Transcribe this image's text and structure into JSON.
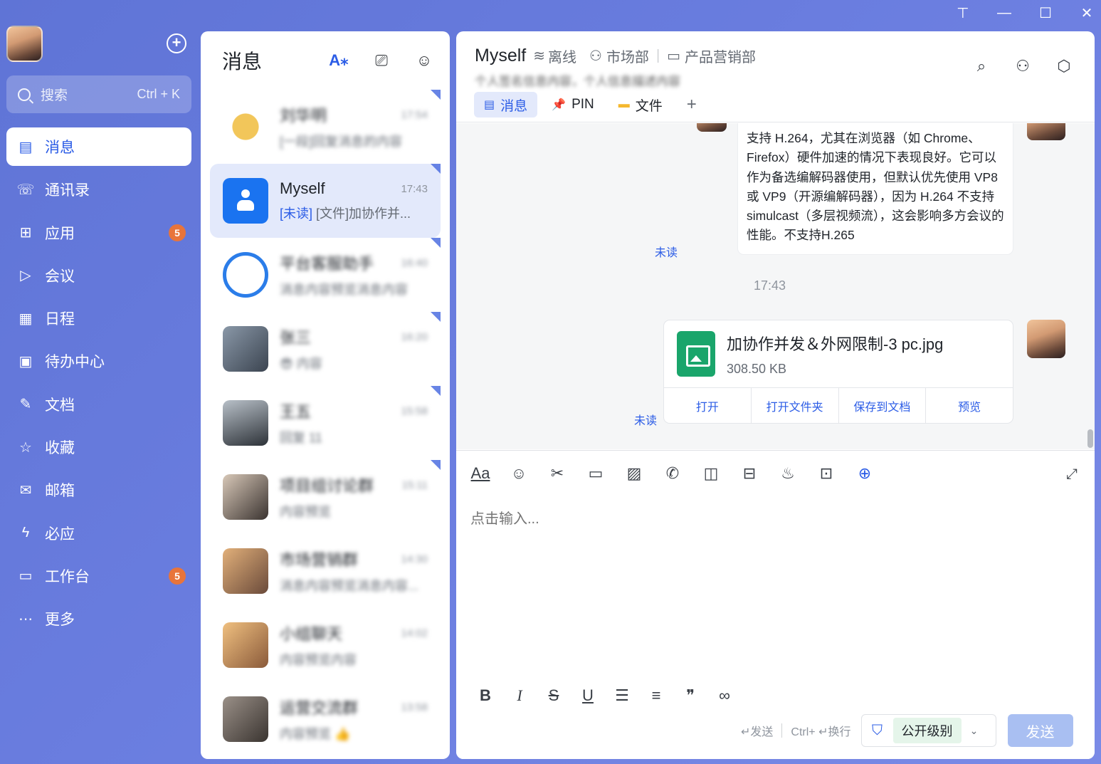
{
  "window": {
    "controls": [
      "pin-icon",
      "minimize-icon",
      "maximize-icon",
      "close-icon"
    ]
  },
  "sidebar": {
    "search": {
      "placeholder": "搜索",
      "shortcut": "Ctrl + K"
    },
    "items": [
      {
        "label": "消息",
        "icon": "message-icon",
        "active": true,
        "badge": ""
      },
      {
        "label": "通讯录",
        "icon": "contacts-icon",
        "badge": ""
      },
      {
        "label": "应用",
        "icon": "apps-icon",
        "badge": "5"
      },
      {
        "label": "会议",
        "icon": "meeting-icon",
        "badge": ""
      },
      {
        "label": "日程",
        "icon": "calendar-icon",
        "badge": ""
      },
      {
        "label": "待办中心",
        "icon": "todo-icon",
        "badge": ""
      },
      {
        "label": "文档",
        "icon": "doc-icon",
        "badge": ""
      },
      {
        "label": "收藏",
        "icon": "favorite-icon",
        "badge": ""
      },
      {
        "label": "邮箱",
        "icon": "mail-icon",
        "badge": ""
      },
      {
        "label": "必应",
        "icon": "bolt-icon",
        "badge": ""
      },
      {
        "label": "工作台",
        "icon": "workbench-icon",
        "badge": "5"
      },
      {
        "label": "更多",
        "icon": "more-icon",
        "badge": ""
      }
    ]
  },
  "list": {
    "title": "消息",
    "conversations": [
      {
        "name": "刘华明",
        "time": "17:54",
        "preview": "[一段]回复消息的内容",
        "blurred": true,
        "color": "#e9b84a"
      },
      {
        "name": "Myself",
        "time": "17:43",
        "unread": "[未读]",
        "preview": "[文件]加协作并...",
        "blurred": false,
        "color": "#1a73f0"
      },
      {
        "name": "平台客服助手",
        "time": "16:40",
        "preview": "消息内容预览消息内容",
        "blurred": true,
        "color": "#2b7de9"
      },
      {
        "name": "张三",
        "time": "16:20",
        "preview": "😎 内容",
        "blurred": true,
        "color": "#4a5566"
      },
      {
        "name": "王五",
        "time": "15:58",
        "preview": "回复 11",
        "blurred": true,
        "color": "#3b4450"
      },
      {
        "name": "项目组讨论群",
        "time": "15:11",
        "preview": "内容预览",
        "blurred": true,
        "color": "#5a4e46"
      },
      {
        "name": "市场营销群",
        "time": "14:30",
        "preview": "消息内容预览消息内容...",
        "blurred": true,
        "color": "#c28a5a"
      },
      {
        "name": "小组聊天",
        "time": "14:02",
        "preview": "内容预览内容",
        "blurred": true,
        "color": "#d09060"
      },
      {
        "name": "运营交流群",
        "time": "13:58",
        "preview": "内容预览 👍",
        "blurred": true,
        "color": "#66605a"
      }
    ]
  },
  "chat": {
    "title": "Myself",
    "status": "离线",
    "department": "市场部",
    "team": "产品营销部",
    "subtitle": "个人签名信息内容，个人信息描述内容",
    "tabs": [
      {
        "label": "消息",
        "icon": "message-icon",
        "active": true
      },
      {
        "label": "PIN",
        "icon": "pin-icon",
        "active": false
      },
      {
        "label": "文件",
        "icon": "folder-icon",
        "active": false
      }
    ],
    "add_tab": "+",
    "message_text": "支持 H.264，尤其在浏览器（如 Chrome、Firefox）硬件加速的情况下表现良好。它可以作为备选编解码器使用，但默认优先使用 VP8 或 VP9（开源编解码器），因为 H.264 不支持 simulcast（多层视频流），这会影响多方会议的性能。不支持H.265",
    "unread_label": "未读",
    "time_divider": "17:43",
    "file": {
      "name": "加协作并发＆外网限制-3 pc.jpg",
      "size": "308.50 KB",
      "actions": [
        "打开",
        "打开文件夹",
        "保存到文档",
        "预览"
      ]
    },
    "composer": {
      "placeholder": "点击输入...",
      "hint_send": "↵发送",
      "hint_newline": "Ctrl+ ↵换行",
      "level": "公开级别",
      "send": "发送"
    }
  },
  "colors": {
    "accent": "#2b5ce6",
    "sidebar_bg": "#6b7ee0",
    "badge": "#e8743b",
    "file_green": "#1aa56b"
  }
}
